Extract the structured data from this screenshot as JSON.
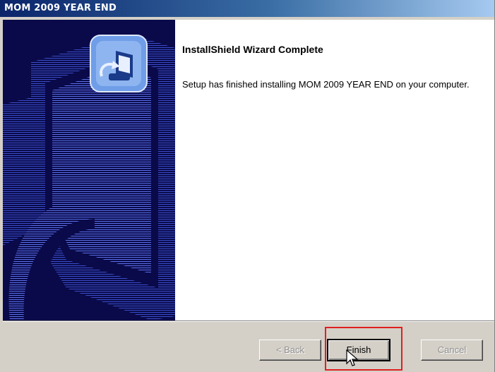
{
  "window": {
    "title": "MOM 2009 YEAR END"
  },
  "content": {
    "heading": "InstallShield Wizard Complete",
    "message": "Setup has finished installing MOM 2009 YEAR END on your computer."
  },
  "buttons": {
    "back_label": "< Back",
    "finish_label": "Finish",
    "cancel_label": "Cancel"
  },
  "colors": {
    "titlebar_start": "#0a246a",
    "sidebar_bg": "#0a0a4a",
    "highlight": "#e02020"
  },
  "icons": [
    "installshield-computer-icon",
    "mouse-cursor-icon"
  ]
}
